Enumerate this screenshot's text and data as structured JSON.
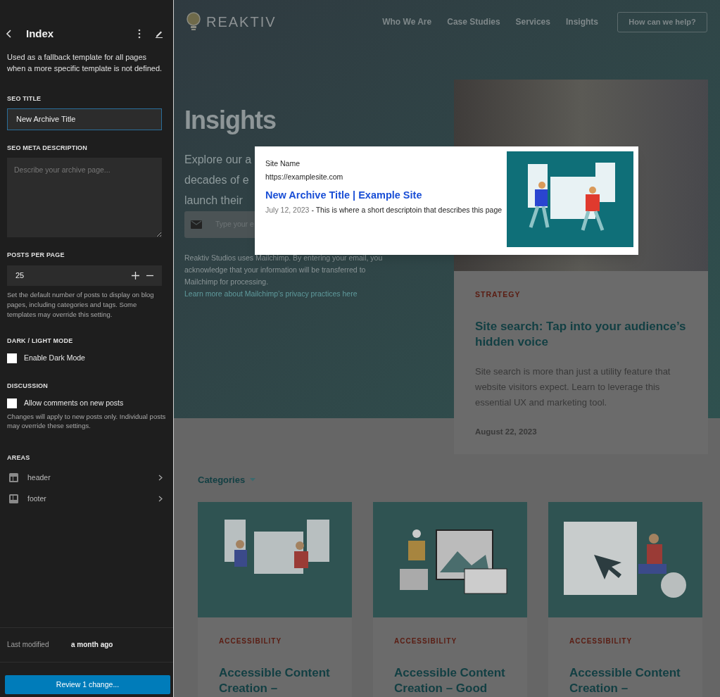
{
  "sidebar": {
    "title": "Index",
    "description": "Used as a fallback template for all pages when a more specific template is not defined.",
    "seo_title": {
      "label": "SEO TITLE",
      "value": "New Archive Title"
    },
    "seo_meta_description": {
      "label": "SEO META DESCRIPTION",
      "placeholder": "Describe your archive page..."
    },
    "posts_per_page": {
      "label": "POSTS PER PAGE",
      "value": "25",
      "help": "Set the default number of posts to display on blog pages, including categories and tags. Some templates may override this setting."
    },
    "dark_light_mode": {
      "label": "DARK / LIGHT MODE",
      "option": {
        "label": "Enable Dark Mode",
        "checked": false
      }
    },
    "discussion": {
      "label": "DISCUSSION",
      "option": {
        "label": "Allow comments on new posts",
        "checked": false
      },
      "help": "Changes will apply to new posts only. Individual posts may override these settings."
    },
    "areas": {
      "label": "AREAS",
      "items": [
        {
          "kind": "header",
          "label": "header"
        },
        {
          "kind": "footer",
          "label": "footer"
        }
      ]
    },
    "last_modified": {
      "label": "Last modified",
      "value": "a month ago"
    },
    "review_button": "Review 1 change..."
  },
  "preview": {
    "logo": "REAKTIV",
    "nav": [
      "Who We Are",
      "Case Studies",
      "Services",
      "Insights"
    ],
    "cta": "How can we help?",
    "hero": {
      "title": "Insights",
      "lines": [
        "Explore our a",
        "decades of e",
        "launch their"
      ],
      "email_placeholder": "Type your e",
      "disclaimer": "Reaktiv Studios uses Mailchimp. By entering your email, you acknowledge that your information will be transferred to Mailchimp for processing.",
      "disclaimer_link": "Learn more about Mailchimp’s privacy practices here"
    },
    "featured": {
      "category": "STRATEGY",
      "title": "Site search: Tap into your audience’s hidden voice",
      "excerpt": "Site search is more than just a utility feature that website visitors expect. Learn to leverage this essential UX and marketing tool.",
      "date": "August 22, 2023"
    },
    "categories_label": "Categories",
    "posts": [
      {
        "category": "ACCESSIBILITY",
        "title": "Accessible Content Creation –"
      },
      {
        "category": "ACCESSIBILITY",
        "title": "Accessible Content Creation – Good"
      },
      {
        "category": "ACCESSIBILITY",
        "title": "Accessible Content Creation –"
      }
    ]
  },
  "search_preview": {
    "site_name": "Site Name",
    "url": "https://examplesite.com",
    "title": "New Archive Title | Example Site",
    "date": "July 12, 2023",
    "description": "- This is where a short descriptoin that describes this page"
  }
}
